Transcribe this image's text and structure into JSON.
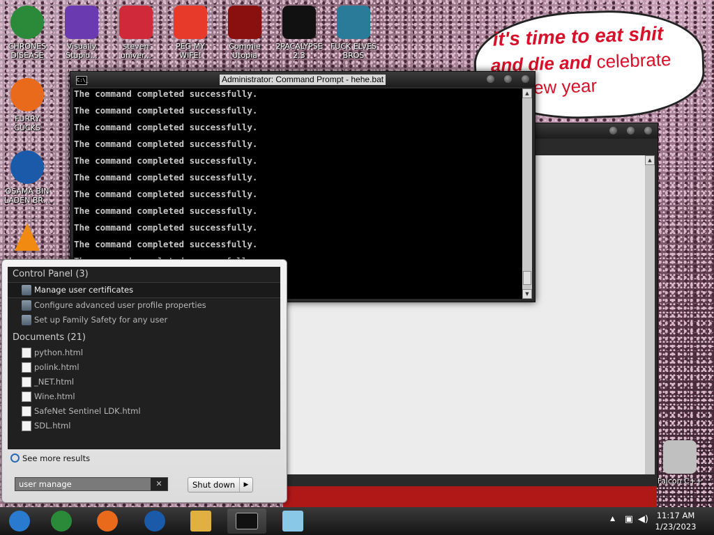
{
  "desktop_icons": [
    {
      "label": "CHRONES DISEASE",
      "icon": "chrome-icon",
      "color": "#2a8a3a"
    },
    {
      "label": "Visually Stupid...",
      "icon": "visual-studio-icon",
      "color": "#6a3ab0"
    },
    {
      "label": "steven univer...",
      "icon": "steven-universe-icon",
      "color": "#d02a3a"
    },
    {
      "label": "PEG MY WIFE!",
      "icon": "peggle-icon",
      "color": "#e83a2a"
    },
    {
      "label": "Commie Utopia",
      "icon": "commie-icon",
      "color": "#8a1010"
    },
    {
      "label": "2PACALYPSE 2.3",
      "icon": "cmd-icon",
      "color": "#111111"
    },
    {
      "label": "FUCK ELVES BROS",
      "icon": "elf-bowling-icon",
      "color": "#2a7a9a"
    },
    {
      "label": "FURRY CUCKS",
      "icon": "firefox-icon",
      "color": "#e86a1a"
    },
    {
      "label": "OSAMA BIN LADEN BR...",
      "icon": "obama-logo-icon",
      "color": "#1a5aa8"
    },
    {
      "label": "",
      "icon": "vlc-icon",
      "color": "#f08a10"
    },
    {
      "label": "Falcon C++",
      "icon": "recycle-bin-icon",
      "color": "#c0c0c0"
    }
  ],
  "meme_text": {
    "line1": "it's time to eat shit",
    "line2_bold": "and die and",
    "line2_rest": " celebrate",
    "line3": "ew year"
  },
  "cmd": {
    "title": "Administrator: Command Prompt - hehe.bat",
    "icon_text": "C:\\_",
    "lines": [
      "The command completed successfully.",
      "The command completed successfully.",
      "The command completed successfully.",
      "The command completed successfully.",
      "The command completed successfully.",
      "The command completed successfully.",
      "The command completed successfully.",
      "The command completed successfully.",
      "The command completed successfully.",
      "The command completed successfully.",
      "The command completed successfully."
    ]
  },
  "start_menu": {
    "control_panel_header": "Control Panel (3)",
    "control_panel_items": [
      {
        "label": "Manage user certificates",
        "icon": "user-certificates-icon",
        "selected": true
      },
      {
        "label": "Configure advanced user profile properties",
        "icon": "system-icon",
        "selected": false
      },
      {
        "label": "Set up Family Safety for any user",
        "icon": "family-safety-icon",
        "selected": false
      }
    ],
    "documents_header": "Documents (21)",
    "documents": [
      "python.html",
      "polink.html",
      "_NET.html",
      "Wine.html",
      "SafeNet Sentinel LDK.html",
      "SDL.html"
    ],
    "see_more": "See more results",
    "search_value": "user manage",
    "shutdown_label": "Shut down"
  },
  "taskbar": {
    "items": [
      {
        "name": "start-button",
        "icon": "windows-orb-icon",
        "color": "#2a7ad0"
      },
      {
        "name": "chrome",
        "icon": "chrome-icon",
        "color": "#2a8a3a"
      },
      {
        "name": "firefox",
        "icon": "firefox-icon",
        "color": "#e86a1a"
      },
      {
        "name": "obama",
        "icon": "obama-logo-icon",
        "color": "#1a5aa8"
      },
      {
        "name": "explorer",
        "icon": "folder-icon",
        "color": "#e0b040"
      },
      {
        "name": "cmd",
        "icon": "cmd-icon",
        "color": "#111111"
      },
      {
        "name": "notepad",
        "icon": "notepad-icon",
        "color": "#8ac8e8"
      }
    ],
    "time": "11:17 AM",
    "date": "1/23/2023"
  }
}
